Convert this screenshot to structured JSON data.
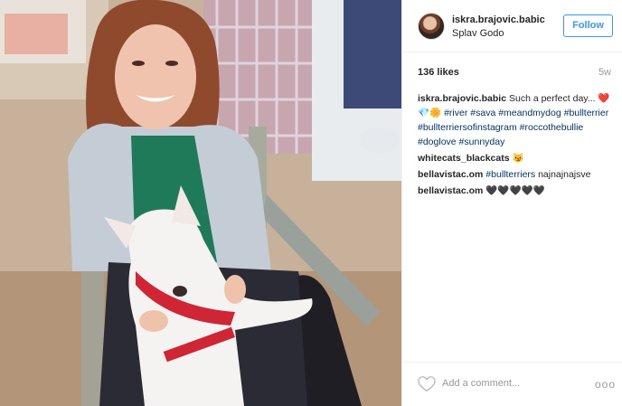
{
  "post": {
    "username": "iskra.brajovic.babic",
    "location": "Splav Godo",
    "follow_label": "Follow",
    "likes": "136 likes",
    "age": "5w"
  },
  "comments": [
    {
      "user": "iskra.brajovic.babic",
      "text": "Such a perfect day... ❤️ 💎🌼 ",
      "tags": [
        "#river",
        "#sava",
        "#meandmydog",
        "#bullterrier",
        "#bullterriersofinstagram",
        "#roccothebullie",
        "#doglove",
        "#sunnyday"
      ]
    },
    {
      "user": "whitecats_blackcats",
      "text": "😼",
      "tags": []
    },
    {
      "user": "bellavistac.om",
      "text": "najnajnajsve",
      "tags": [
        "#bullterriers"
      ]
    },
    {
      "user": "bellavistac.om",
      "text": "🖤🖤🖤🖤🖤",
      "tags": []
    }
  ],
  "footer": {
    "comment_placeholder": "Add a comment...",
    "like_icon": "heart-outline-icon",
    "more_icon": "ellipsis-icon",
    "more_label": "ooo"
  },
  "colors": {
    "accent": "#3897f0",
    "hashtag": "#003569",
    "divider": "#efefef",
    "muted": "#999999"
  }
}
